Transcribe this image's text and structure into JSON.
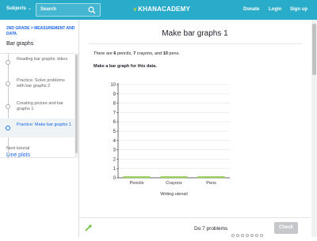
{
  "header": {
    "subjects_label": "Subjects",
    "search_placeholder": "Search",
    "logo_text": "KHANACADEMY",
    "nav": {
      "donate": "Donate",
      "login": "Login",
      "signup": "Sign up"
    },
    "bar_color": "#29abca"
  },
  "sidebar": {
    "breadcrumb": "2ND GRADE > MEASUREMENT AND DATA",
    "section_title": "Bar graphs",
    "items": [
      {
        "label": "Reading bar graphs: bikes",
        "active": false
      },
      {
        "label": "Practice: Solve problems with bar graphs 2",
        "active": false
      },
      {
        "label": "Creating picture and bar graphs 1",
        "active": false
      },
      {
        "label": "Practice: Make bar graphs 1",
        "active": true
      }
    ],
    "next_tutorial_label": "Next tutorial",
    "next_tutorial_link": "Line plots"
  },
  "main": {
    "title": "Make bar graphs 1",
    "prompt": {
      "pre": "There are ",
      "n1": "6",
      "mid1": " pencils, ",
      "n2": "7",
      "mid2": " crayons, and ",
      "n3": "10",
      "post": " pens."
    },
    "instruction": "Make a bar graph for this data."
  },
  "chart_data": {
    "type": "bar",
    "categories": [
      "Pencils",
      "Crayons",
      "Pens"
    ],
    "values": [
      0,
      0,
      0
    ],
    "xlabel": "Writing utensil",
    "ylabel": "",
    "ylim": [
      0,
      10
    ],
    "yticks": [
      0,
      1,
      2,
      3,
      4,
      5,
      6,
      7,
      8,
      9,
      10
    ],
    "grid": true,
    "bar_color": "#9cd35a"
  },
  "footer": {
    "do_label": "Do 7 problems",
    "dot_count": 7,
    "check_label": "Check"
  }
}
